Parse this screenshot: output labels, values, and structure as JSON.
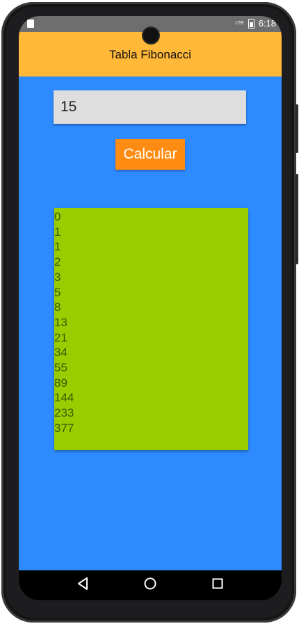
{
  "status_bar": {
    "time": "6:18",
    "network": "LTE",
    "icons": [
      "sim-icon",
      "signal-icon",
      "battery-icon"
    ]
  },
  "app_bar": {
    "title": "Tabla Fibonacci"
  },
  "input": {
    "value": "15"
  },
  "button": {
    "label": "Calcular"
  },
  "results": [
    "0",
    "1",
    "1",
    "2",
    "3",
    "5",
    "8",
    "13",
    "21",
    "34",
    "55",
    "89",
    "144",
    "233",
    "377"
  ],
  "nav_bar": {
    "icons": [
      "back-icon",
      "home-icon",
      "recent-apps-icon"
    ]
  },
  "colors": {
    "app_bar": "#ffb837",
    "background": "#2e8bff",
    "button": "#ff8c12",
    "result_box": "#9acd00",
    "input": "#dedede"
  }
}
